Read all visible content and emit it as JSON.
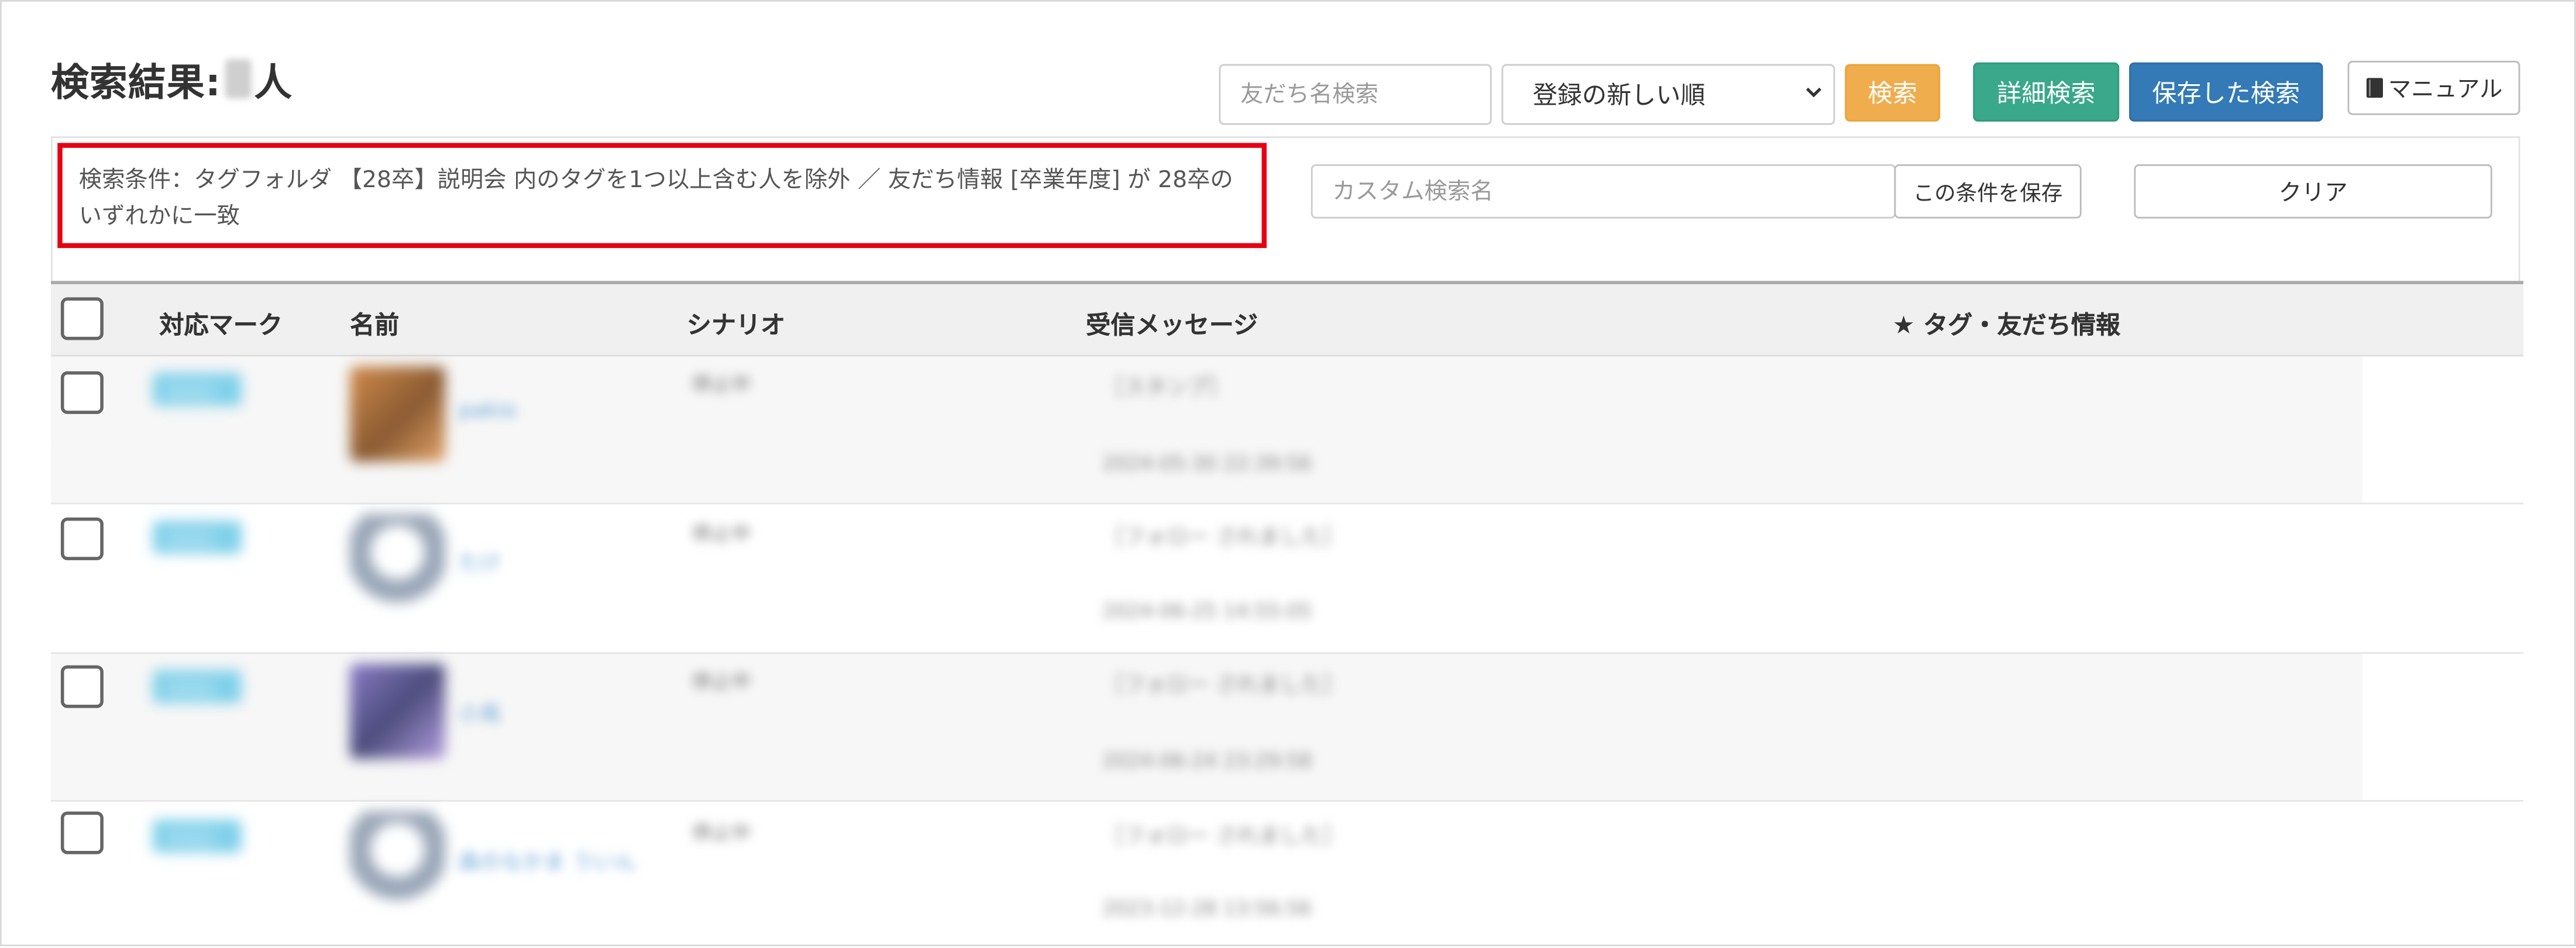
{
  "header": {
    "title_prefix": "検索結果:",
    "title_suffix": "人"
  },
  "toolbar": {
    "friend_search_placeholder": "友だち名検索",
    "sort_selected": "登録の新しい順",
    "search_button": "検索",
    "detail_search_button": "詳細検索",
    "saved_search_button": "保存した検索",
    "manual_button": "マニュアル"
  },
  "condition": {
    "text": "検索条件：タグフォルダ 【28卒】説明会 内のタグを1つ以上含む人を除外 ／ 友だち情報 [卒業年度] が 28卒のいずれかに一致",
    "custom_name_placeholder": "カスタム検索名",
    "save_button": "この条件を保存",
    "clear_button": "クリア"
  },
  "table": {
    "columns": {
      "mark": "対応マーク",
      "name": "名前",
      "scenario": "シナリオ",
      "message": "受信メッセージ",
      "tags": "★ タグ・友だち情報"
    },
    "rows": [
      {
        "badge": "未対応",
        "name": "pakio",
        "scenario": "停止中",
        "message": "［スタンプ］",
        "time": "2024-05-30 22:39:56"
      },
      {
        "badge": "未対応",
        "name": "たけ",
        "scenario": "停止中",
        "message": "［フォロー されました］",
        "time": "2024-06-25 14:55:05"
      },
      {
        "badge": "未対応",
        "name": "小鳥",
        "scenario": "停止中",
        "message": "［フォロー されました］",
        "time": "2024-06-24 23:29:58"
      },
      {
        "badge": "未対応",
        "name": "森のなかま ういん",
        "scenario": "停止中",
        "message": "［フォロー されました］",
        "time": "2023-12-28 13:56:56"
      }
    ]
  },
  "colors": {
    "highlight_border": "#e60012",
    "search_button": "#f0ad4e",
    "detail_search_button": "#3aa88a",
    "saved_search_button": "#337ab7"
  },
  "icons": {
    "manual": "book-icon",
    "sort": "chevron-down-icon"
  }
}
